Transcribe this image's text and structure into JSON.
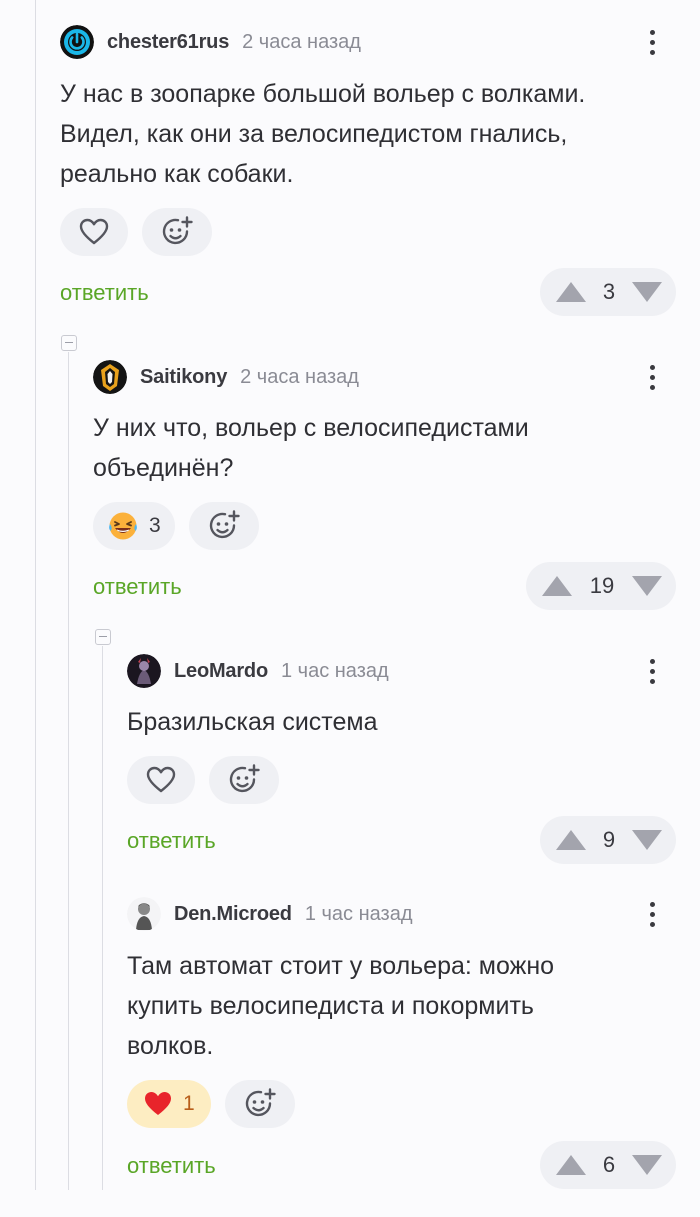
{
  "colors": {
    "accent_green": "#5aa627",
    "heart_red": "#e8242b",
    "active_pill": "#fdedc2"
  },
  "comments": [
    {
      "username": "chester61rus",
      "time": "2 часа назад",
      "body": "У нас в зоопарке большой вольер с волками. Видел, как они за велосипедистом гнались, реально как собаки.",
      "reactions": [
        {
          "icon": "heart-outline-icon",
          "count": ""
        },
        {
          "icon": "add-emoji-icon",
          "count": ""
        }
      ],
      "reply_label": "ответить",
      "score": "3"
    },
    {
      "username": "Saitikony",
      "time": "2 часа назад",
      "body": "У них что, вольер с велосипедистами объединён?",
      "reactions": [
        {
          "icon": "laughing-emoji-icon",
          "count": "3"
        },
        {
          "icon": "add-emoji-icon",
          "count": ""
        }
      ],
      "reply_label": "ответить",
      "score": "19"
    },
    {
      "username": "LeoMardo",
      "time": "1 час назад",
      "body": "Бразильская система",
      "reactions": [
        {
          "icon": "heart-outline-icon",
          "count": ""
        },
        {
          "icon": "add-emoji-icon",
          "count": ""
        }
      ],
      "reply_label": "ответить",
      "score": "9"
    },
    {
      "username": "Den.Microed",
      "time": "1 час назад",
      "body": "Там автомат стоит у вольера: можно купить велосипедиста и покормить волков.",
      "reactions": [
        {
          "icon": "heart-filled-icon",
          "count": "1"
        },
        {
          "icon": "add-emoji-icon",
          "count": ""
        }
      ],
      "reply_label": "ответить",
      "score": "6"
    }
  ]
}
